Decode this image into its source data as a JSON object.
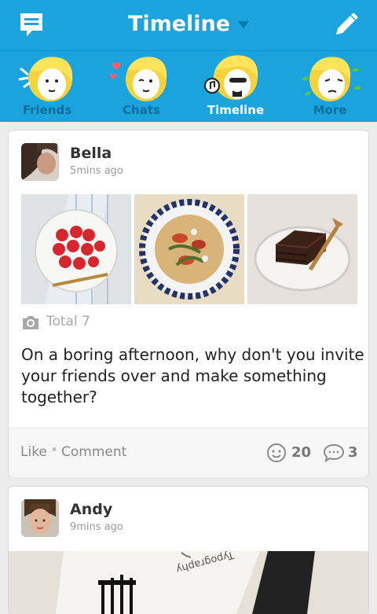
{
  "header": {
    "title": "Timeline"
  },
  "tabs": [
    {
      "label": "Friends",
      "active": false
    },
    {
      "label": "Chats",
      "active": false
    },
    {
      "label": "Timeline",
      "active": true
    },
    {
      "label": "More",
      "active": false
    }
  ],
  "posts": [
    {
      "user": "Bella",
      "time": "5mins ago",
      "photos": [
        "strawberries",
        "salad",
        "chocolate-cake"
      ],
      "photo_total": "Total 7",
      "text": "On a boring afternoon, why don't you invite your friends over and make something together?",
      "like_label": "Like",
      "separator": "•",
      "comment_label": "Comment",
      "smiles": "20",
      "comments": "3"
    },
    {
      "user": "Andy",
      "time": "9mins ago",
      "photo_caption": "Typography"
    }
  ],
  "colors": {
    "header_bg": "#1aa3dc",
    "tab_inactive": "#0d6f9c",
    "tab_active": "#ffffff"
  }
}
